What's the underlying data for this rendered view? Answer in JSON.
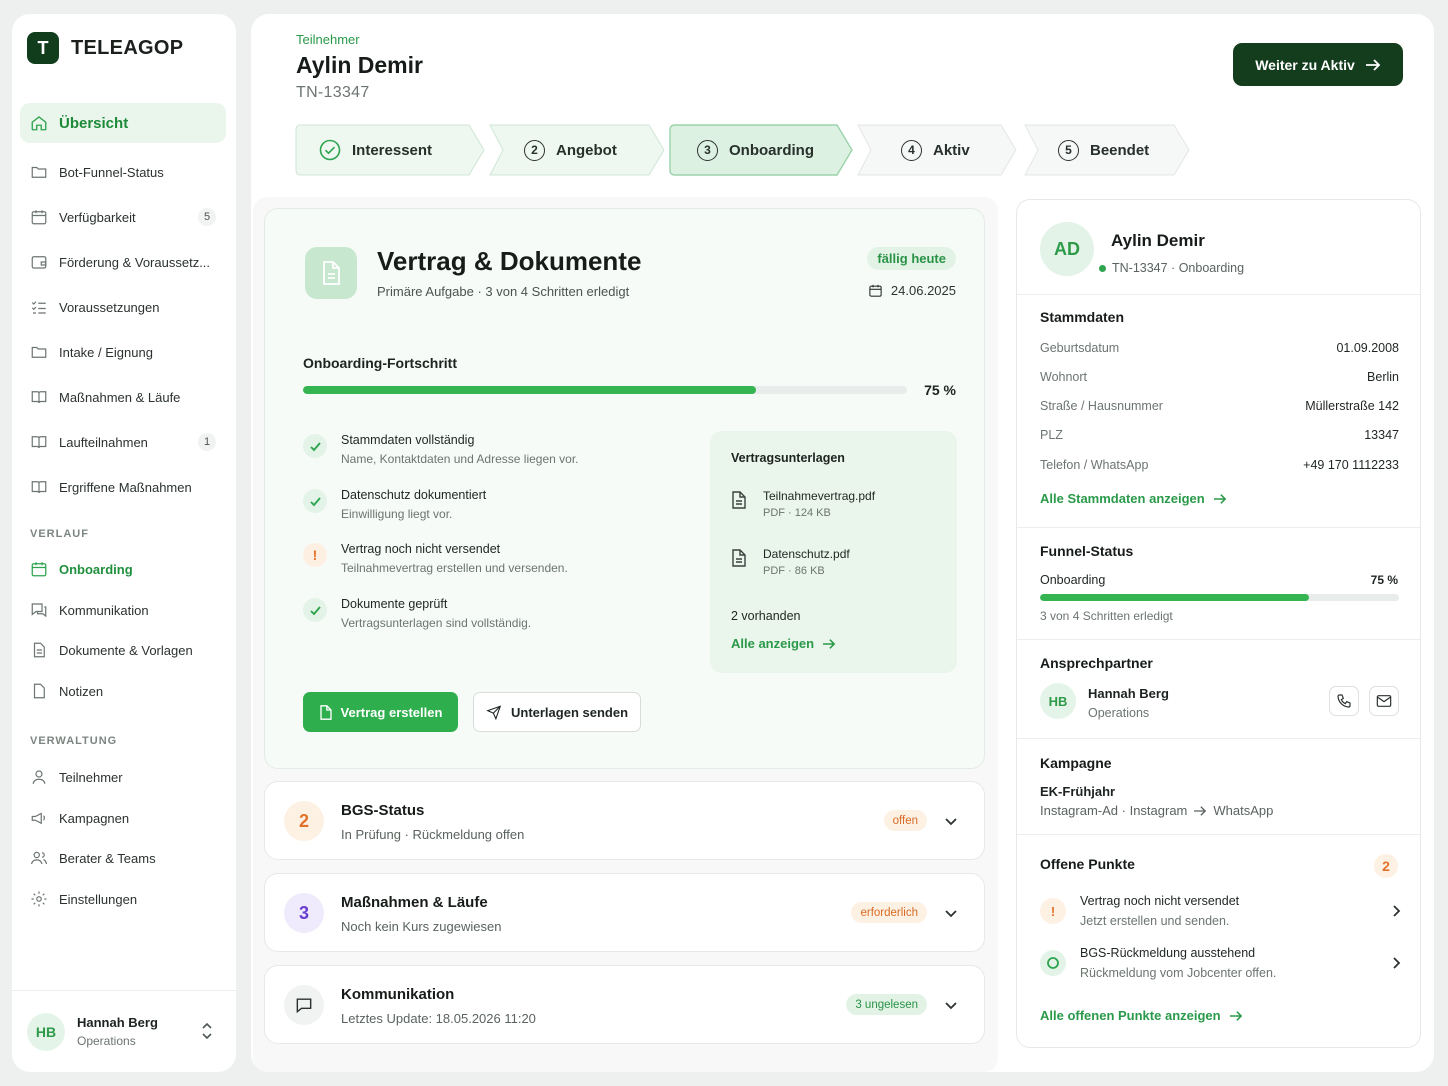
{
  "brand": {
    "logo_letter": "T",
    "name": "TELEAGOP"
  },
  "sidebar": {
    "items": [
      {
        "label": "Übersicht",
        "icon": "home-icon"
      },
      {
        "label": "Bot-Funnel-Status",
        "icon": "folder-icon"
      },
      {
        "label": "Verfügbarkeit",
        "icon": "calendar-icon",
        "count": "5"
      },
      {
        "label": "Förderung & Voraussetz...",
        "icon": "wallet-icon"
      },
      {
        "label": "Voraussetzungen",
        "icon": "checklist-icon"
      },
      {
        "label": "Intake / Eignung",
        "icon": "folder-icon"
      },
      {
        "label": "Maßnahmen & Läufe",
        "icon": "book-icon"
      },
      {
        "label": "Laufteilnahmen",
        "icon": "book-icon",
        "count": "1"
      },
      {
        "label": "Ergriffene Maßnahmen",
        "icon": "book-icon"
      }
    ],
    "section_verlauf": "VERLAUF",
    "verlauf_items": [
      {
        "label": "Onboarding",
        "icon": "calendar-icon"
      },
      {
        "label": "Kommunikation",
        "icon": "chat-icon"
      },
      {
        "label": "Dokumente & Vorlagen",
        "icon": "document-icon"
      },
      {
        "label": "Notizen",
        "icon": "note-icon"
      }
    ],
    "section_verwaltung": "VERWALTUNG",
    "verwaltung_items": [
      {
        "label": "Teilnehmer",
        "icon": "user-icon"
      },
      {
        "label": "Kampagnen",
        "icon": "megaphone-icon"
      },
      {
        "label": "Berater & Teams",
        "icon": "users-icon"
      },
      {
        "label": "Einstellungen",
        "icon": "gear-icon"
      }
    ],
    "user": {
      "initials": "HB",
      "name": "Hannah Berg",
      "role": "Operations"
    }
  },
  "header": {
    "breadcrumb": "Teilnehmer",
    "title": "Aylin Demir",
    "id": "TN-13347",
    "primary_button": "Weiter zu Aktiv"
  },
  "steps": [
    {
      "num": "",
      "label": "Interessent",
      "state": "done"
    },
    {
      "num": "2",
      "label": "Angebot",
      "state": "done"
    },
    {
      "num": "3",
      "label": "Onboarding",
      "state": "current"
    },
    {
      "num": "4",
      "label": "Aktiv",
      "state": "todo"
    },
    {
      "num": "5",
      "label": "Beendet",
      "state": "todo"
    }
  ],
  "task": {
    "title": "Vertrag & Dokumente",
    "subtitle": "Primäre Aufgabe · 3 von 4 Schritten erledigt",
    "badge": "fällig heute",
    "due_date": "24.06.2025",
    "progress_label": "Onboarding-Fortschritt",
    "progress_value": 0.75,
    "progress_text": "75 %",
    "checklist": [
      {
        "title": "Stammdaten vollständig",
        "desc": "Name, Kontaktdaten und Adresse liegen vor.",
        "status": "done"
      },
      {
        "title": "Datenschutz dokumentiert",
        "desc": "Einwilligung liegt vor.",
        "status": "done"
      },
      {
        "title": "Vertrag noch nicht versendet",
        "desc": "Teilnahmevertrag erstellen und versenden.",
        "status": "warning"
      },
      {
        "title": "Dokumente geprüft",
        "desc": "Vertragsunterlagen sind vollständig.",
        "status": "done"
      }
    ],
    "docs": {
      "title": "Vertragsunterlagen",
      "files": [
        {
          "name": "Teilnahmevertrag.pdf",
          "meta": "PDF · 124 KB"
        },
        {
          "name": "Datenschutz.pdf",
          "meta": "PDF · 86 KB"
        }
      ],
      "count": "2 vorhanden",
      "link": "Alle anzeigen"
    },
    "btn_create": "Vertrag erstellen",
    "btn_send": "Unterlagen senden"
  },
  "cards": [
    {
      "num": "2",
      "title": "BGS-Status",
      "subtitle": "In Prüfung · Rückmeldung offen",
      "badge": "offen"
    },
    {
      "num": "3",
      "title": "Maßnahmen & Läufe",
      "subtitle": "Noch kein Kurs zugewiesen",
      "badge": "erforderlich"
    },
    {
      "num": "",
      "title": "Kommunikation",
      "subtitle": "Letztes Update: 18.05.2026 11:20",
      "badge": "3 ungelesen"
    }
  ],
  "profile": {
    "initials": "AD",
    "name": "Aylin Demir",
    "meta": "TN-13347 · Onboarding",
    "stammdaten_title": "Stammdaten",
    "stammdaten": [
      {
        "key": "Geburtsdatum",
        "value": "01.09.2008"
      },
      {
        "key": "Wohnort",
        "value": "Berlin"
      },
      {
        "key": "Straße / Hausnummer",
        "value": "Müllerstraße 142"
      },
      {
        "key": "PLZ",
        "value": "13347"
      },
      {
        "key": "Telefon / WhatsApp",
        "value": "+49 170 1112233"
      }
    ],
    "stammdaten_link": "Alle Stammdaten anzeigen",
    "funnel_title": "Funnel-Status",
    "funnel_label": "Onboarding",
    "funnel_pct": "75 %",
    "funnel_value": 0.75,
    "funnel_sub": "3 von 4 Schritten erledigt",
    "contact_title": "Ansprechpartner",
    "contact": {
      "initials": "HB",
      "name": "Hannah Berg",
      "role": "Operations"
    },
    "campaign_title": "Kampagne",
    "campaign_name": "EK-Frühjahr",
    "campaign_path_a": "Instagram-Ad · Instagram",
    "campaign_path_b": "WhatsApp",
    "open_title": "Offene Punkte",
    "open_count": "2",
    "open_items": [
      {
        "title": "Vertrag noch nicht versendet",
        "desc": "Jetzt erstellen und senden.",
        "status": "warning"
      },
      {
        "title": "BGS-Rückmeldung ausstehend",
        "desc": "Rückmeldung vom Jobcenter offen.",
        "status": "pending"
      }
    ],
    "open_link": "Alle offenen Punkte anzeigen"
  },
  "colors": {
    "accent": "#2ea44f",
    "dark_green": "#143d1e",
    "warning": "#e2722b",
    "purple": "#6a3fd0"
  }
}
